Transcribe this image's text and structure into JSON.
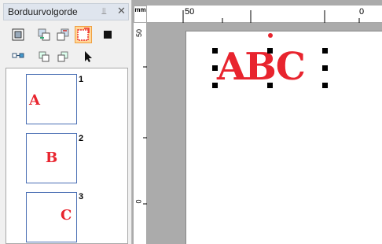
{
  "panel": {
    "title": "Borduurvolgorde",
    "pin_icon": "pin-icon",
    "close_icon": "close-icon",
    "toolbar_row1": [
      "select-all-icon",
      "move-to-front-icon",
      "move-to-back-icon",
      "selected-frame-icon",
      "color-block-icon"
    ],
    "toolbar_row2": [
      "merge-icon",
      "combine-icon",
      "split-icon",
      "pointer-arrow-icon"
    ],
    "items": [
      {
        "number": "1",
        "letter": "A"
      },
      {
        "number": "2",
        "letter": "B"
      },
      {
        "number": "3",
        "letter": "C"
      }
    ]
  },
  "ruler": {
    "unit": "mm",
    "h_labels": [
      "50",
      "0"
    ],
    "v_labels": [
      "50",
      "0"
    ]
  },
  "canvas": {
    "text": "ABC",
    "text_color": "#e8242e"
  }
}
